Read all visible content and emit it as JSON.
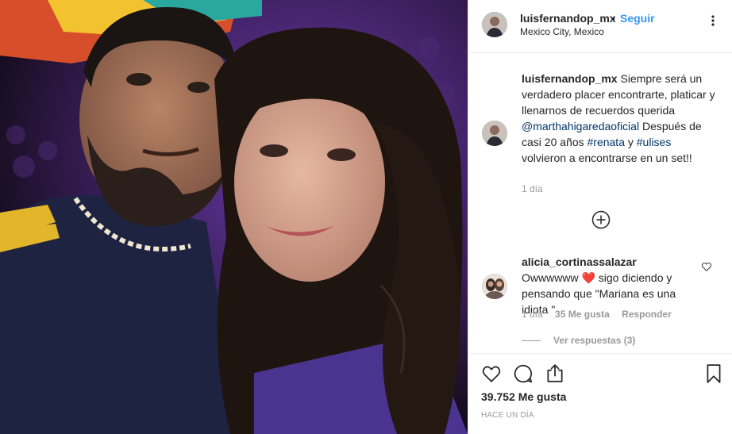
{
  "post": {
    "photo_icon": "selfie-photo",
    "author": {
      "username": "luisfernandop_mx",
      "separator": "•",
      "follow_label": "Seguir",
      "location": "Mexico City, Mexico"
    },
    "more_icon": "more-options-icon",
    "caption": {
      "username": "luisfernandop_mx",
      "text_part1": " Siempre será un verdadero placer encontrarte, platicar y llenarnos de recuerdos querida ",
      "mention": "@marthahigaredaoficial",
      "text_part2": " Después de casi 20 años ",
      "hashtag1": "#renata",
      "text_part3": " y ",
      "hashtag2": "#ulises",
      "text_part4": " volvieron a encontrarse en un set!!",
      "time": "1 día"
    },
    "load_more_icon": "plus-circle-icon",
    "comments": [
      {
        "username": "alicia_cortinassalazar",
        "text_part1": " Owwwwww ",
        "emoji": "❤️",
        "text_part2": " sigo diciendo y pensando que \"Mariana es una idiota \"",
        "time": "1 día",
        "likes": "35 Me gusta",
        "reply_label": "Responder",
        "view_replies": "Ver respuestas (3)"
      }
    ],
    "actions": {
      "like_icon": "heart-icon",
      "comment_icon": "comment-icon",
      "share_icon": "share-icon",
      "save_icon": "bookmark-icon"
    },
    "likes_count": "39.752 Me gusta",
    "posted": "HACE UN DÍA"
  },
  "colors": {
    "link": "#3897f0",
    "mention": "#003569",
    "muted": "#999999",
    "heart": "#ed4956"
  }
}
